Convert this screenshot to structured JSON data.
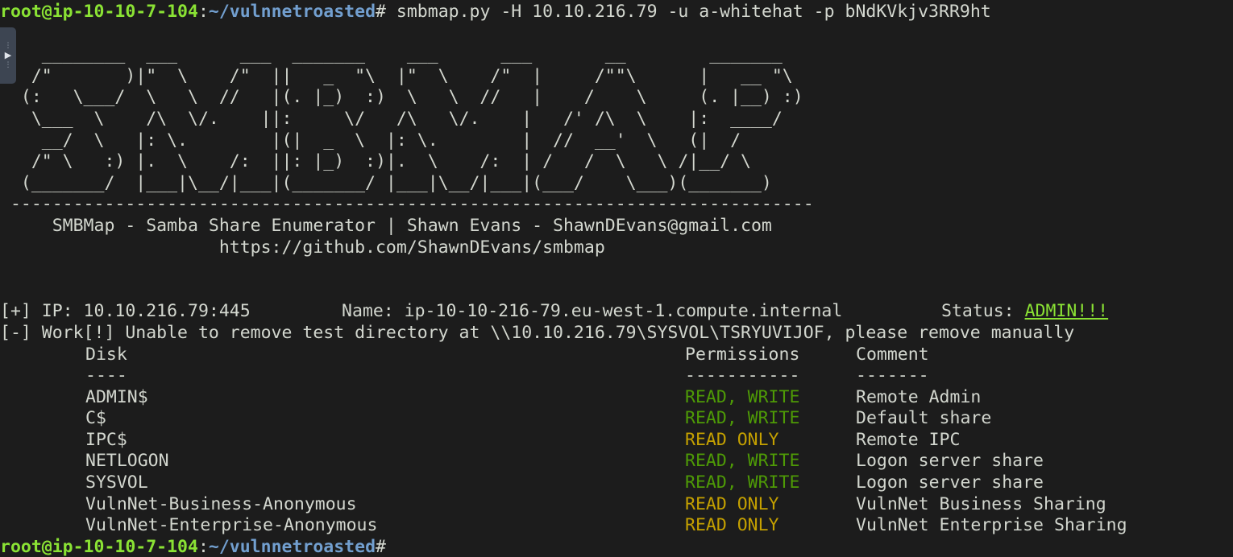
{
  "prompt": {
    "user_host": "root@ip-10-10-7-104",
    "separator": ":",
    "path": "~/vulnnetroasted",
    "symbol": "#"
  },
  "command": " smbmap.py -H 10.10.216.79 -u a-whitehat -p bNdKVkjv3RR9ht",
  "banner": {
    "art_lines": [
      "    ________  ___      ___  _______    ___      ___       __        _______",
      "   /\"       )|\"  \\    /\"  ||   _  \"\\  |\"  \\    /\"  |     /\"\"\\      |   __ \"\\",
      "  (:   \\___/  \\   \\  //   |(. |_)  :)  \\   \\  //   |    /    \\     (. |__) :)",
      "   \\___  \\    /\\  \\/.    ||:     \\/   /\\   \\/.    |   /' /\\  \\    |:  ____/",
      "    __/  \\   |: \\.        |(|  _  \\  |: \\.        |  //  __'  \\   (|  /",
      "   /\" \\   :) |.  \\    /:  ||: |_)  :)|.  \\    /:  | /   /  \\   \\ /|__/ \\",
      "  (_______/  |___|\\__/|___|(_______/ |___|\\__/|___|(___/    \\___)(_______)",
      " -----------------------------------------------------------------------------"
    ],
    "tagline": "     SMBMap - Samba Share Enumerator | Shawn Evans - ShawnDEvans@gmail.com",
    "url": "                     https://github.com/ShawnDEvans/smbmap"
  },
  "result": {
    "ip_prefix": "[+] IP: 10.10.216.79:445",
    "name": "Name: ip-10-10-216-79.eu-west-1.compute.internal",
    "status_label": "Status: ",
    "status_value": "ADMIN!!!",
    "warning": "[-] Work[!] Unable to remove test directory at \\\\10.10.216.79\\SYSVOL\\TSRYUVIJOF, please remove manually"
  },
  "table": {
    "headers": {
      "disk": "Disk",
      "permissions": "Permissions",
      "comment": "Comment"
    },
    "underlines": {
      "disk": "----",
      "permissions": "-----------",
      "comment": "-------"
    },
    "rows": [
      {
        "disk": "ADMIN$",
        "permissions": "READ, WRITE",
        "comment": "Remote Admin",
        "kind": "rw"
      },
      {
        "disk": "C$",
        "permissions": "READ, WRITE",
        "comment": "Default share",
        "kind": "rw"
      },
      {
        "disk": "IPC$",
        "permissions": "READ ONLY",
        "comment": "Remote IPC",
        "kind": "ro"
      },
      {
        "disk": "NETLOGON",
        "permissions": "READ, WRITE",
        "comment": "Logon server share",
        "kind": "rw"
      },
      {
        "disk": "SYSVOL",
        "permissions": "READ, WRITE",
        "comment": "Logon server share",
        "kind": "rw"
      },
      {
        "disk": "VulnNet-Business-Anonymous",
        "permissions": "READ ONLY",
        "comment": "VulnNet Business Sharing",
        "kind": "ro"
      },
      {
        "disk": "VulnNet-Enterprise-Anonymous",
        "permissions": "READ ONLY",
        "comment": "VulnNet Enterprise Sharing",
        "kind": "ro"
      }
    ]
  },
  "colors": {
    "background": "#1c1c1c",
    "prompt_user": "#8ae234",
    "prompt_path": "#729fcf",
    "perm_rw": "#4e9a06",
    "perm_ro": "#c4a000"
  },
  "side_handle": {
    "icon": "play-arrow-icon"
  }
}
